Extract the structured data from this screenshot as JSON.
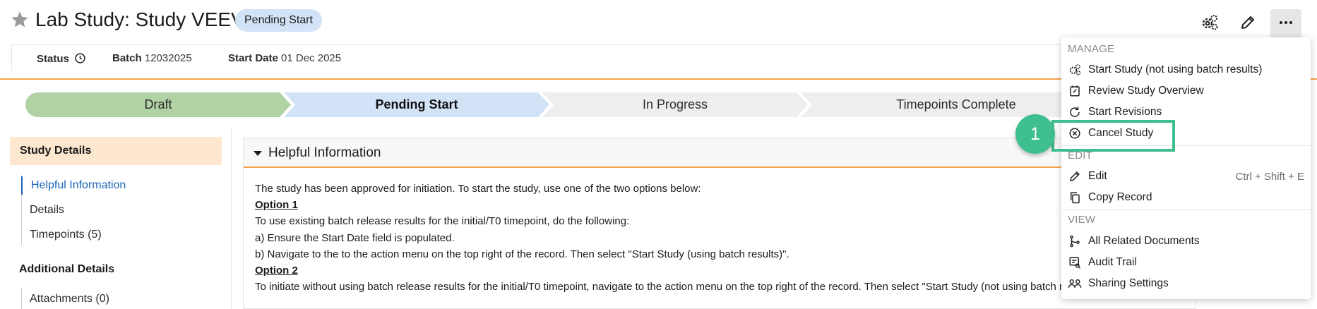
{
  "header": {
    "title": "Lab Study: Study VEEV",
    "state_badge": "Pending Start"
  },
  "infobar": {
    "status_label": "Status",
    "batch_label": "Batch",
    "batch_value": "12032025",
    "start_date_label": "Start Date",
    "start_date_value": "01 Dec 2025"
  },
  "lifecycle": {
    "steps": [
      "Draft",
      "Pending Start",
      "In Progress",
      "Timepoints Complete"
    ],
    "current": "Pending Start"
  },
  "sidebar": {
    "study_details": "Study Details",
    "items": [
      "Helpful Information",
      "Details",
      "Timepoints (5)"
    ],
    "additional_details": "Additional Details",
    "additional_items": [
      "Attachments (0)"
    ]
  },
  "panel": {
    "title": "Helpful Information",
    "lines": [
      "The study has been approved for initiation. To start the study, use one of the two options below:",
      "Option 1",
      "To use existing batch release results for the initial/T0 timepoint, do the following:",
      "a) Ensure the Start Date field is populated.",
      "b) Navigate to the to the action menu on the top right of the record. Then select \"Start Study (using batch results)\".",
      "Option 2",
      "To initiate without using batch release results for the initial/T0 timepoint, navigate to the action menu on the top right of the record. Then select  \"Start Study (not using batch results)\"."
    ]
  },
  "menu": {
    "manage_label": "MANAGE",
    "manage_items": [
      "Start Study (not using batch results)",
      "Review Study Overview",
      "Start Revisions",
      "Cancel Study"
    ],
    "edit_label": "EDIT",
    "edit_items": [
      "Edit",
      "Copy Record"
    ],
    "edit_shortcut": "Ctrl + Shift + E",
    "view_label": "VIEW",
    "view_items": [
      "All Related Documents",
      "Audit Trail",
      "Sharing Settings"
    ]
  },
  "annotation": {
    "step_number": "1"
  },
  "colors": {
    "accent_orange": "#f7a447",
    "draft_green": "#b1d2a5",
    "pending_blue": "#d3e3f7",
    "link_blue": "#1a63b8",
    "annotation_green": "#3fbf8f"
  }
}
